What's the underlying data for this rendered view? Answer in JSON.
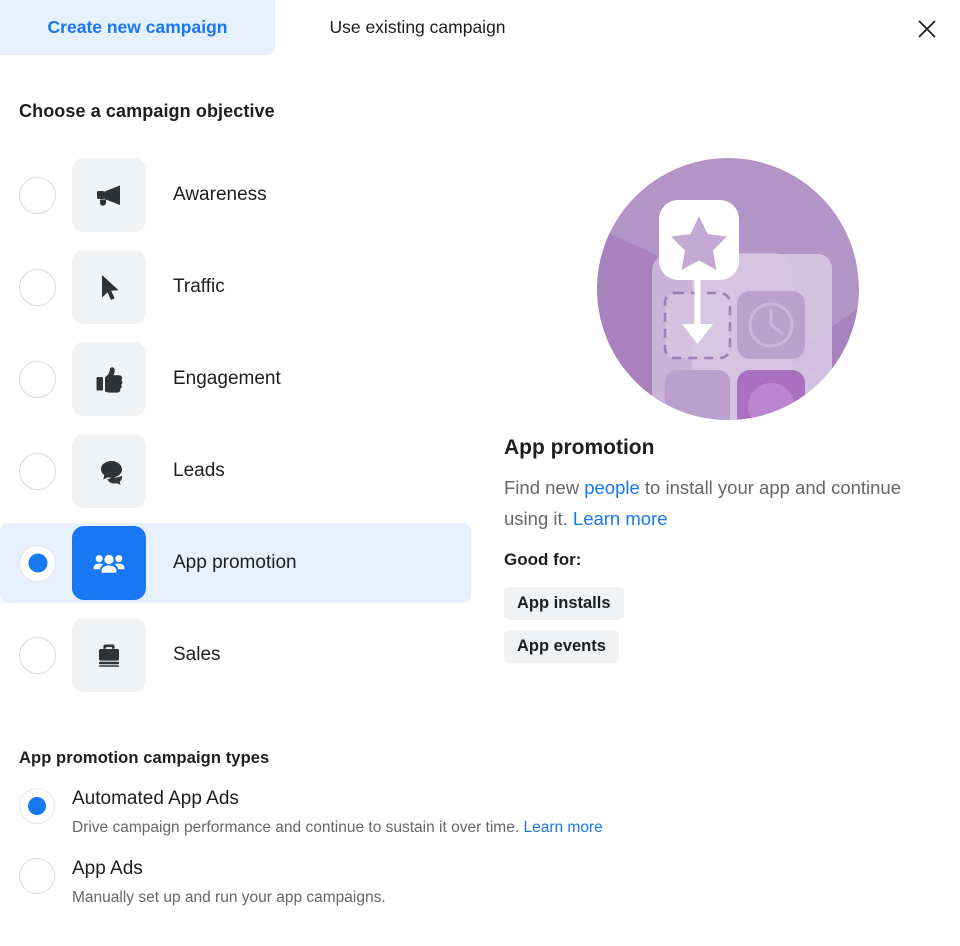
{
  "tabs": [
    {
      "label": "Create new campaign",
      "active": true
    },
    {
      "label": "Use existing campaign",
      "active": false
    }
  ],
  "close_label": "Close",
  "objective_section": {
    "title": "Choose a campaign objective",
    "items": [
      {
        "label": "Awareness",
        "icon": "megaphone-icon",
        "selected": false
      },
      {
        "label": "Traffic",
        "icon": "cursor-icon",
        "selected": false
      },
      {
        "label": "Engagement",
        "icon": "thumbs-up-icon",
        "selected": false
      },
      {
        "label": "Leads",
        "icon": "speech-bubbles-icon",
        "selected": false
      },
      {
        "label": "App promotion",
        "icon": "people-group-icon",
        "selected": true
      },
      {
        "label": "Sales",
        "icon": "briefcase-icon",
        "selected": false
      }
    ]
  },
  "detail": {
    "illustration_name": "app-promotion-illustration",
    "title": "App promotion",
    "desc_part1": "Find new ",
    "desc_link1": "people",
    "desc_part2": " to install your app and continue using it. ",
    "desc_link2": "Learn more",
    "good_for_label": "Good for:",
    "badges": [
      "App installs",
      "App events"
    ]
  },
  "types_section": {
    "title": "App promotion campaign types",
    "items": [
      {
        "title": "Automated App Ads",
        "sub": "Drive campaign performance and continue to sustain it over time. ",
        "sub_link": "Learn more",
        "selected": true
      },
      {
        "title": "App Ads",
        "sub": "Manually set up and run your app campaigns.",
        "sub_link": "",
        "selected": false
      }
    ]
  },
  "colors": {
    "accent": "#1877f2",
    "selected_row_bg": "#e7f0fd",
    "tile_bg": "#f1f2f4",
    "illustration_purple": "#ab8ec0"
  }
}
